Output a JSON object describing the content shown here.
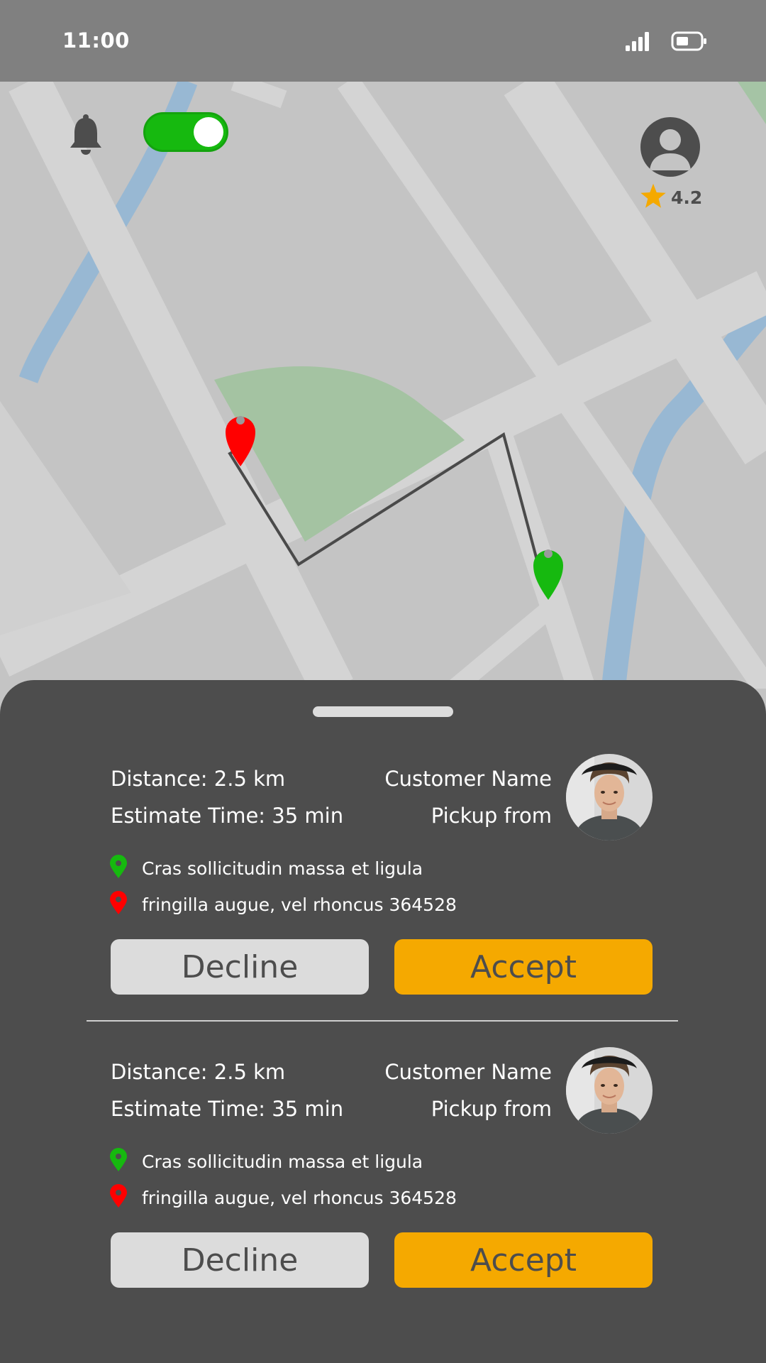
{
  "status_bar": {
    "time": "11:00",
    "icons": [
      "signal-icon",
      "battery-icon"
    ]
  },
  "header": {
    "notification_icon": "bell-icon",
    "online_toggle": {
      "state": "on",
      "color": "#16b90f"
    },
    "profile_icon": "user-avatar-icon",
    "rating": "4.2",
    "rating_icon": "star-icon"
  },
  "map": {
    "pickup_marker_color": "#16b90f",
    "dropoff_marker_color": "#ff0000"
  },
  "requests": [
    {
      "distance": "Distance: 2.5 km",
      "estimate": "Estimate Time: 35 min",
      "customer_name": "Customer Name",
      "pickup_label": "Pickup from",
      "pickup_address": "Cras sollicitudin massa et ligula",
      "dropoff_address": "fringilla augue, vel rhoncus 364528",
      "decline_label": "Decline",
      "accept_label": "Accept"
    },
    {
      "distance": "Distance: 2.5 km",
      "estimate": "Estimate Time: 35 min",
      "customer_name": "Customer Name",
      "pickup_label": "Pickup from",
      "pickup_address": "Cras sollicitudin massa et ligula",
      "dropoff_address": "fringilla augue, vel rhoncus 364528",
      "decline_label": "Decline",
      "accept_label": "Accept"
    }
  ],
  "colors": {
    "accent": "#f5a900",
    "sheet": "#4d4d4d",
    "toggle_on": "#16b90f"
  }
}
